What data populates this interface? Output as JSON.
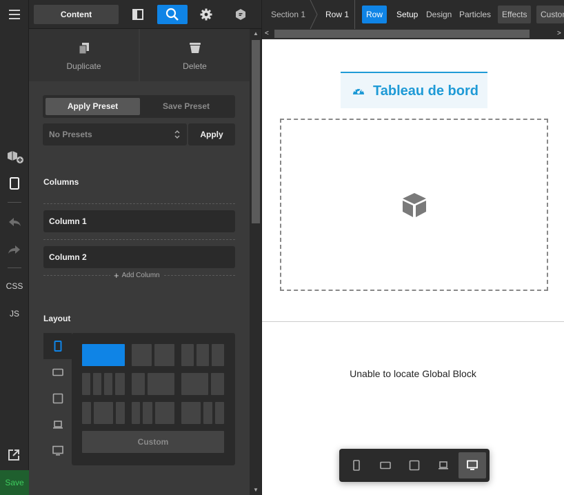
{
  "rail": {
    "css_label": "CSS",
    "js_label": "JS",
    "save_label": "Save",
    "icons": [
      "hamburger-icon",
      "add-block-icon",
      "mobile-icon",
      "undo-icon",
      "redo-icon",
      "external-link-icon"
    ]
  },
  "topbar": {
    "content_label": "Content",
    "icons": [
      "panel-toggle-icon",
      "search-icon",
      "gear-icon",
      "tag-icon"
    ]
  },
  "actions": {
    "duplicate_label": "Duplicate",
    "delete_label": "Delete"
  },
  "presets": {
    "apply_preset_label": "Apply Preset",
    "save_preset_label": "Save Preset",
    "select_value": "No Presets",
    "apply_label": "Apply"
  },
  "columns": {
    "title": "Columns",
    "items": [
      "Column 1",
      "Column 2"
    ],
    "add_label": "Add Column"
  },
  "layout": {
    "title": "Layout",
    "custom_label": "Custom"
  },
  "breadcrumb": {
    "section": "Section 1",
    "row": "Row 1"
  },
  "tabs": {
    "row": "Row",
    "setup": "Setup",
    "design": "Design",
    "particles": "Particles",
    "effects": "Effects",
    "custom": "Custom"
  },
  "canvas": {
    "heading": "Tableau de bord",
    "global_block_message": "Unable to locate Global Block"
  },
  "colors": {
    "accent": "#0f84e6",
    "heading": "#1e9ad6",
    "save_bg": "#1f5f2e",
    "save_text": "#3ecb5e"
  }
}
